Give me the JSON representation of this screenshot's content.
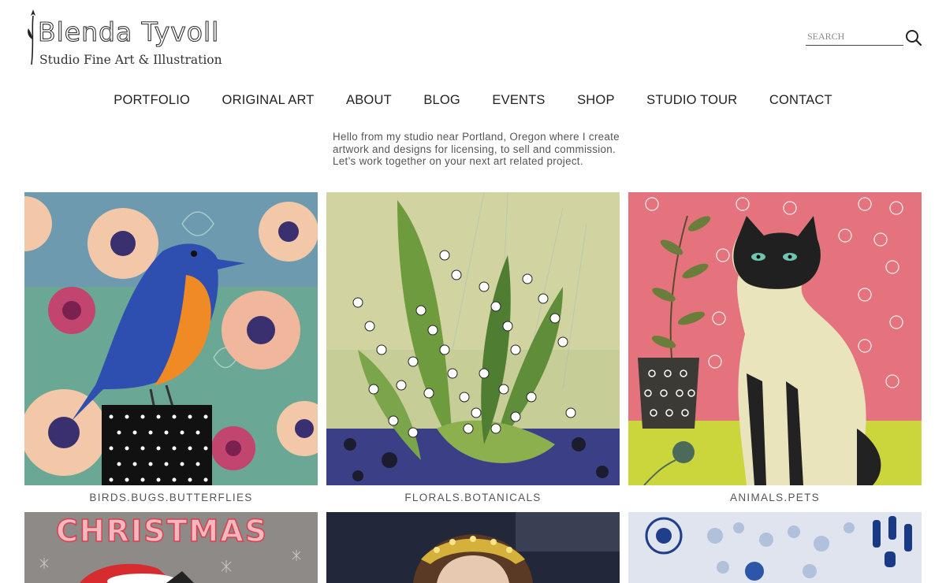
{
  "logo": {
    "title": "Blenda Tyvoll",
    "subtitle": "Studio Fine Art & Illustration",
    "icon": "tulip-icon"
  },
  "search": {
    "placeholder": "SEARCH",
    "icon": "search-icon"
  },
  "nav": {
    "items": [
      "PORTFOLIO",
      "ORIGINAL ART",
      "ABOUT",
      "BLOG",
      "EVENTS",
      "SHOP",
      "STUDIO TOUR",
      "CONTACT"
    ]
  },
  "intro": {
    "text": "Hello from my studio near Portland, Oregon where I create artwork and designs for licensing, to sell and commission. Let’s work together on your next art related project."
  },
  "gallery": {
    "tiles": [
      {
        "caption": "BIRDS.BUGS.BUTTERFLIES"
      },
      {
        "caption": "FLORALS.BOTANICALS"
      },
      {
        "caption": "ANIMALS.PETS"
      }
    ],
    "row2": [
      {
        "banner_text": "CHRISTMAS"
      },
      {},
      {}
    ]
  },
  "colors": {
    "text": "#333333",
    "bird_bg": "#6aa795",
    "botanical_bg": "#c7cd96",
    "pet_bg": "#e4737d",
    "pet_floor": "#cbd63c"
  }
}
